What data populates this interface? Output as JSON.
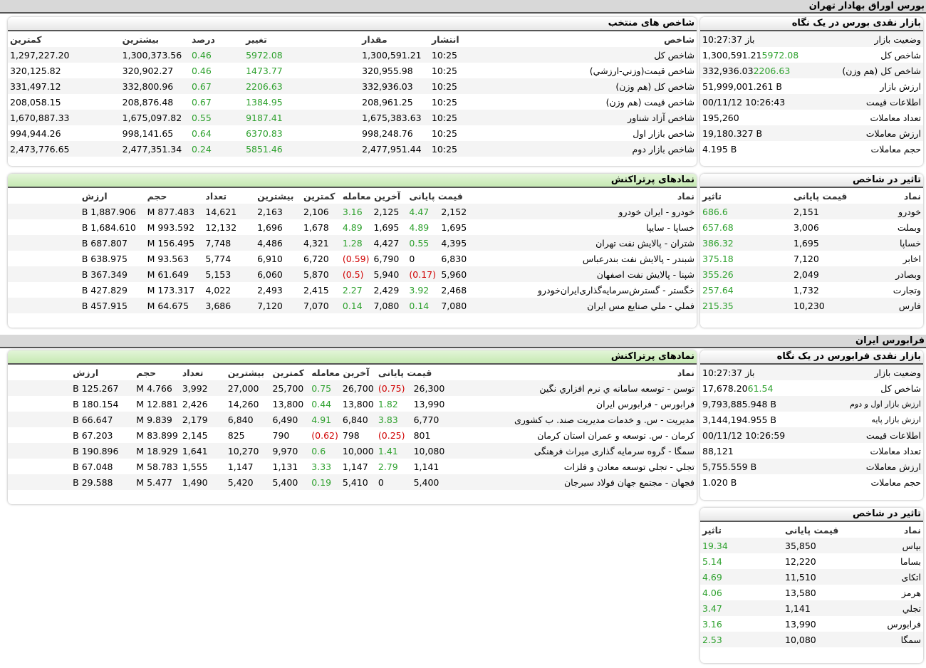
{
  "colors": {
    "positive": "#2ea12e",
    "negative": "#d00000",
    "header_green": "#c6e9b3"
  },
  "tse": {
    "section_title": "بورس اوراق بهادار تهران",
    "glance": {
      "title": "بازار نقدی بورس در یک نگاه",
      "rows": [
        {
          "label": "وضعیت بازار",
          "value": "باز 10:27:37",
          "change": "",
          "cls": ""
        },
        {
          "label": "شاخص کل",
          "value": "1,300,591.21",
          "change": "5972.08",
          "cls": "pos"
        },
        {
          "label": "شاخص کل (هم وزن)",
          "value": "332,936.03",
          "change": "2206.63",
          "cls": "pos"
        },
        {
          "label": "ارزش بازار",
          "value": "51,999,001.261 B",
          "change": "",
          "cls": ""
        },
        {
          "label": "اطلاعات قیمت",
          "value": "00/11/12 10:26:43",
          "change": "",
          "cls": ""
        },
        {
          "label": "تعداد معاملات",
          "value": "195,260",
          "change": "",
          "cls": ""
        },
        {
          "label": "ارزش معاملات",
          "value": "19,180.327 B",
          "change": "",
          "cls": ""
        },
        {
          "label": "حجم معاملات",
          "value": "4.195 B",
          "change": "",
          "cls": ""
        }
      ]
    },
    "indices": {
      "title": "شاخص های منتخب",
      "headers": [
        "شاخص",
        "انتشار",
        "مقدار",
        "تغییر",
        "درصد",
        "بیشترین",
        "کمترین"
      ],
      "rows": [
        {
          "name": "شاخص کل",
          "time": "10:25",
          "value": "1,300,591.21",
          "change": "5972.08",
          "pct": "0.46",
          "high": "1,300,373.56",
          "low": "1,297,227.20",
          "cls": "pos"
        },
        {
          "name": "شاخص قیمت(وزني-ارزشي)",
          "time": "10:25",
          "value": "320,955.98",
          "change": "1473.77",
          "pct": "0.46",
          "high": "320,902.27",
          "low": "320,125.82",
          "cls": "pos"
        },
        {
          "name": "شاخص کل (هم وزن)",
          "time": "10:25",
          "value": "332,936.03",
          "change": "2206.63",
          "pct": "0.67",
          "high": "332,800.96",
          "low": "331,497.12",
          "cls": "pos"
        },
        {
          "name": "شاخص قیمت (هم وزن)",
          "time": "10:25",
          "value": "208,961.25",
          "change": "1384.95",
          "pct": "0.67",
          "high": "208,876.48",
          "low": "208,058.15",
          "cls": "pos"
        },
        {
          "name": "شاخص آزاد شناور",
          "time": "10:25",
          "value": "1,675,383.63",
          "change": "9187.41",
          "pct": "0.55",
          "high": "1,675,097.82",
          "low": "1,670,887.33",
          "cls": "pos"
        },
        {
          "name": "شاخص بازار اول",
          "time": "10:25",
          "value": "998,248.76",
          "change": "6370.83",
          "pct": "0.64",
          "high": "998,141.65",
          "low": "994,944.26",
          "cls": "pos"
        },
        {
          "name": "شاخص بازار دوم",
          "time": "10:25",
          "value": "2,477,951.44",
          "change": "5851.46",
          "pct": "0.24",
          "high": "2,477,351.34",
          "low": "2,473,776.65",
          "cls": "pos"
        }
      ]
    },
    "impact": {
      "title": "تاثیر در شاخص",
      "headers": [
        "نماد",
        "قیمت پایانی",
        "تاثیر"
      ],
      "rows": [
        {
          "symbol": "خودرو",
          "price": "2,151",
          "impact": "686.6",
          "cls": "pos"
        },
        {
          "symbol": "وبملت",
          "price": "3,006",
          "impact": "657.68",
          "cls": "pos"
        },
        {
          "symbol": "خساپا",
          "price": "1,695",
          "impact": "386.32",
          "cls": "pos"
        },
        {
          "symbol": "اخابر",
          "price": "7,120",
          "impact": "375.18",
          "cls": "pos"
        },
        {
          "symbol": "وبصادر",
          "price": "2,049",
          "impact": "355.26",
          "cls": "pos"
        },
        {
          "symbol": "وتجارت",
          "price": "1,732",
          "impact": "257.64",
          "cls": "pos"
        },
        {
          "symbol": "فارس",
          "price": "10,230",
          "impact": "215.35",
          "cls": "pos"
        }
      ]
    },
    "active": {
      "title": "نمادهای پرتراکنش",
      "headers": [
        "نماد",
        "قیمت پایانی",
        "",
        "آخرین معامله",
        "",
        "کمترین",
        "بیشترین",
        "تعداد",
        "حجم",
        "ارزش"
      ],
      "rows": [
        {
          "symbol": "خودرو - ایران خودرو",
          "close": "2,152",
          "close_pct": "4.47",
          "close_cls": "pos",
          "last": "2,125",
          "last_pct": "3.16",
          "last_cls": "pos",
          "low": "2,106",
          "high": "2,163",
          "count": "14,621",
          "volume": "877.483 M",
          "value": "1,887.906 B"
        },
        {
          "symbol": "خساپا - سایپا",
          "close": "1,695",
          "close_pct": "4.89",
          "close_cls": "pos",
          "last": "1,695",
          "last_pct": "4.89",
          "last_cls": "pos",
          "low": "1,678",
          "high": "1,696",
          "count": "12,132",
          "volume": "993.592 M",
          "value": "1,684.610 B"
        },
        {
          "symbol": "شتران - پالایش نفت تهران",
          "close": "4,395",
          "close_pct": "0.55",
          "close_cls": "pos",
          "last": "4,427",
          "last_pct": "1.28",
          "last_cls": "pos",
          "low": "4,321",
          "high": "4,486",
          "count": "7,748",
          "volume": "156.495 M",
          "value": "687.807 B"
        },
        {
          "symbol": "شبندر - پالایش نفت بندرعباس",
          "close": "6,830",
          "close_pct": "0",
          "close_cls": "",
          "last": "6,790",
          "last_pct": "(0.59)",
          "last_cls": "neg",
          "low": "6,720",
          "high": "6,910",
          "count": "5,774",
          "volume": "93.563 M",
          "value": "638.975 B"
        },
        {
          "symbol": "شپنا - پالایش نفت اصفهان",
          "close": "5,960",
          "close_pct": "(0.17)",
          "close_cls": "neg",
          "last": "5,940",
          "last_pct": "(0.5)",
          "last_cls": "neg",
          "low": "5,870",
          "high": "6,060",
          "count": "5,153",
          "volume": "61.649 M",
          "value": "367.349 B"
        },
        {
          "symbol": "خگستر - گسترش‌سرمایه‌گذاری‌ایران‌خودرو",
          "close": "2,468",
          "close_pct": "3.92",
          "close_cls": "pos",
          "last": "2,429",
          "last_pct": "2.27",
          "last_cls": "pos",
          "low": "2,415",
          "high": "2,493",
          "count": "4,022",
          "volume": "173.317 M",
          "value": "427.829 B"
        },
        {
          "symbol": "فملي - ملي صنايع مس ايران",
          "close": "7,080",
          "close_pct": "0.14",
          "close_cls": "pos",
          "last": "7,080",
          "last_pct": "0.14",
          "last_cls": "pos",
          "low": "7,070",
          "high": "7,120",
          "count": "3,686",
          "volume": "64.675 M",
          "value": "457.915 B"
        }
      ]
    }
  },
  "ifb": {
    "section_title": "فرابورس ایران",
    "glance": {
      "title": "بازار نقدی فرابورس در یک نگاه",
      "rows": [
        {
          "label": "وضعیت بازار",
          "value": "باز 10:27:37",
          "change": "",
          "cls": ""
        },
        {
          "label": "شاخص کل",
          "value": "17,678.20",
          "change": "61.54",
          "cls": "pos"
        },
        {
          "label": "ارزش بازار اول و دوم",
          "value": "9,793,885.948 B",
          "change": "",
          "cls": "",
          "small": true
        },
        {
          "label": "ارزش بازار پایه",
          "value": "3,144,194.955 B",
          "change": "",
          "cls": "",
          "small": true
        },
        {
          "label": "اطلاعات قیمت",
          "value": "00/11/12 10:26:59",
          "change": "",
          "cls": ""
        },
        {
          "label": "تعداد معاملات",
          "value": "88,121",
          "change": "",
          "cls": ""
        },
        {
          "label": "ارزش معاملات",
          "value": "5,755.559 B",
          "change": "",
          "cls": ""
        },
        {
          "label": "حجم معاملات",
          "value": "1.020 B",
          "change": "",
          "cls": ""
        }
      ]
    },
    "impact": {
      "title": "تاثیر در شاخص",
      "headers": [
        "نماد",
        "قیمت پایانی",
        "تاثیر"
      ],
      "rows": [
        {
          "symbol": "بپاس",
          "price": "35,850",
          "impact": "19.34",
          "cls": "pos"
        },
        {
          "symbol": "بساما",
          "price": "12,220",
          "impact": "5.14",
          "cls": "pos"
        },
        {
          "symbol": "اتکای",
          "price": "11,510",
          "impact": "4.69",
          "cls": "pos"
        },
        {
          "symbol": "هرمز",
          "price": "13,580",
          "impact": "4.06",
          "cls": "pos"
        },
        {
          "symbol": "تجلي",
          "price": "1,141",
          "impact": "3.47",
          "cls": "pos"
        },
        {
          "symbol": "فرابورس",
          "price": "13,990",
          "impact": "3.16",
          "cls": "pos"
        },
        {
          "symbol": "سمگا",
          "price": "10,080",
          "impact": "2.53",
          "cls": "pos"
        }
      ]
    },
    "active": {
      "title": "نمادهای پرتراکنش",
      "headers": [
        "نماد",
        "قیمت پایانی",
        "",
        "آخرین معامله",
        "",
        "کمترین",
        "بیشترین",
        "تعداد",
        "حجم",
        "ارزش"
      ],
      "rows": [
        {
          "symbol": "توسن - توسعه سامانه ي نرم افزاري نگين",
          "close": "26,300",
          "close_pct": "(0.75)",
          "close_cls": "neg",
          "last": "26,700",
          "last_pct": "0.75",
          "last_cls": "pos",
          "low": "25,700",
          "high": "27,000",
          "count": "3,992",
          "volume": "4.766 M",
          "value": "125.267 B"
        },
        {
          "symbol": "فرابورس - فرابورس ایران",
          "close": "13,990",
          "close_pct": "1.82",
          "close_cls": "pos",
          "last": "13,800",
          "last_pct": "0.44",
          "last_cls": "pos",
          "low": "13,800",
          "high": "14,260",
          "count": "2,426",
          "volume": "12.881 M",
          "value": "180.154 B"
        },
        {
          "symbol": "مدیریت - س. و خدمات مدیریت صند. ب کشوری",
          "close": "6,770",
          "close_pct": "3.83",
          "close_cls": "pos",
          "last": "6,840",
          "last_pct": "4.91",
          "last_cls": "pos",
          "low": "6,490",
          "high": "6,840",
          "count": "2,179",
          "volume": "9.839 M",
          "value": "66.647 B"
        },
        {
          "symbol": "کرمان - س. توسعه و عمران استان کرمان",
          "close": "801",
          "close_pct": "(0.25)",
          "close_cls": "neg",
          "last": "798",
          "last_pct": "(0.62)",
          "last_cls": "neg",
          "low": "790",
          "high": "825",
          "count": "2,145",
          "volume": "83.899 M",
          "value": "67.203 B"
        },
        {
          "symbol": "سمگا - گروه سرمایه گذاری میراث فرهنگی",
          "close": "10,080",
          "close_pct": "1.41",
          "close_cls": "pos",
          "last": "10,000",
          "last_pct": "0.6",
          "last_cls": "pos",
          "low": "9,970",
          "high": "10,270",
          "count": "1,641",
          "volume": "18.929 M",
          "value": "190.896 B"
        },
        {
          "symbol": "تجلي - تجلي توسعه معادن و فلزات",
          "close": "1,141",
          "close_pct": "2.79",
          "close_cls": "pos",
          "last": "1,147",
          "last_pct": "3.33",
          "last_cls": "pos",
          "low": "1,131",
          "high": "1,147",
          "count": "1,555",
          "volume": "58.783 M",
          "value": "67.048 B"
        },
        {
          "symbol": "فجهان - مجتمع جهان فولاد سيرجان",
          "close": "5,400",
          "close_pct": "0",
          "close_cls": "",
          "last": "5,410",
          "last_pct": "0.19",
          "last_cls": "pos",
          "low": "5,400",
          "high": "5,420",
          "count": "1,490",
          "volume": "5.477 M",
          "value": "29.588 B"
        }
      ]
    }
  }
}
